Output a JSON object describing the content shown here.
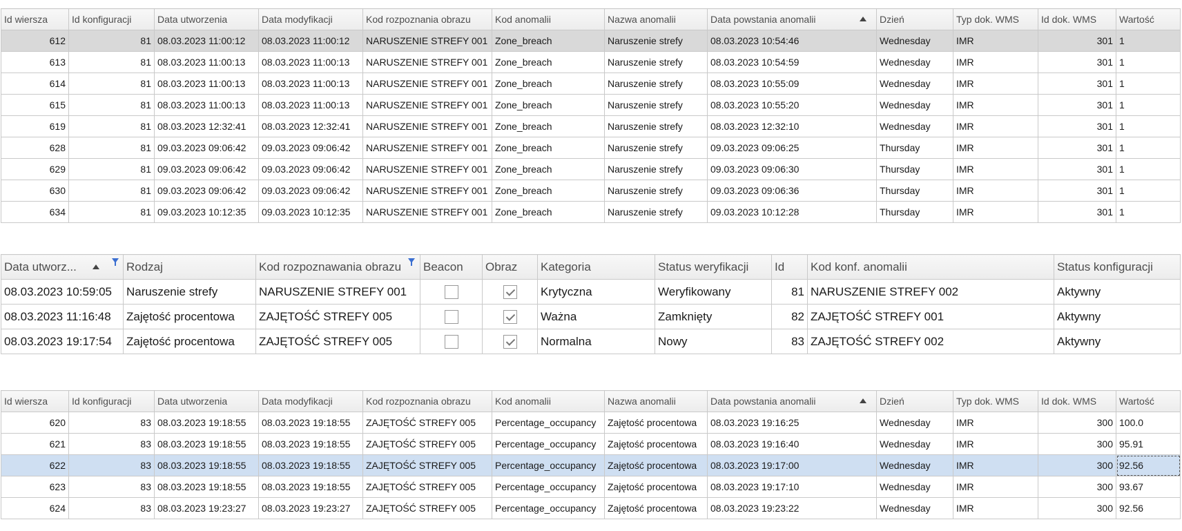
{
  "grid1": {
    "columns": [
      "Id wiersza",
      "Id konfiguracji",
      "Data utworzenia",
      "Data modyfikacji",
      "Kod rozpoznania obrazu",
      "Kod anomalii",
      "Nazwa anomalii",
      "Data powstania anomalii",
      "Dzień",
      "Typ dok. WMS",
      "Id dok. WMS",
      "Wartość"
    ],
    "sorted_column": "Data powstania anomalii",
    "sort_direction": "ascending",
    "rows": [
      [
        "612",
        "81",
        "08.03.2023 11:00:12",
        "08.03.2023 11:00:12",
        "NARUSZENIE STREFY 001",
        "Zone_breach",
        "Naruszenie strefy",
        "08.03.2023 10:54:46",
        "Wednesday",
        "IMR",
        "301",
        "1"
      ],
      [
        "613",
        "81",
        "08.03.2023 11:00:13",
        "08.03.2023 11:00:13",
        "NARUSZENIE STREFY 001",
        "Zone_breach",
        "Naruszenie strefy",
        "08.03.2023 10:54:59",
        "Wednesday",
        "IMR",
        "301",
        "1"
      ],
      [
        "614",
        "81",
        "08.03.2023 11:00:13",
        "08.03.2023 11:00:13",
        "NARUSZENIE STREFY 001",
        "Zone_breach",
        "Naruszenie strefy",
        "08.03.2023 10:55:09",
        "Wednesday",
        "IMR",
        "301",
        "1"
      ],
      [
        "615",
        "81",
        "08.03.2023 11:00:13",
        "08.03.2023 11:00:13",
        "NARUSZENIE STREFY 001",
        "Zone_breach",
        "Naruszenie strefy",
        "08.03.2023 10:55:20",
        "Wednesday",
        "IMR",
        "301",
        "1"
      ],
      [
        "619",
        "81",
        "08.03.2023 12:32:41",
        "08.03.2023 12:32:41",
        "NARUSZENIE STREFY 001",
        "Zone_breach",
        "Naruszenie strefy",
        "08.03.2023 12:32:10",
        "Wednesday",
        "IMR",
        "301",
        "1"
      ],
      [
        "628",
        "81",
        "09.03.2023 09:06:42",
        "09.03.2023 09:06:42",
        "NARUSZENIE STREFY 001",
        "Zone_breach",
        "Naruszenie strefy",
        "09.03.2023 09:06:25",
        "Thursday",
        "IMR",
        "301",
        "1"
      ],
      [
        "629",
        "81",
        "09.03.2023 09:06:42",
        "09.03.2023 09:06:42",
        "NARUSZENIE STREFY 001",
        "Zone_breach",
        "Naruszenie strefy",
        "09.03.2023 09:06:30",
        "Thursday",
        "IMR",
        "301",
        "1"
      ],
      [
        "630",
        "81",
        "09.03.2023 09:06:42",
        "09.03.2023 09:06:42",
        "NARUSZENIE STREFY 001",
        "Zone_breach",
        "Naruszenie strefy",
        "09.03.2023 09:06:36",
        "Thursday",
        "IMR",
        "301",
        "1"
      ],
      [
        "634",
        "81",
        "09.03.2023 10:12:35",
        "09.03.2023 10:12:35",
        "NARUSZENIE STREFY 001",
        "Zone_breach",
        "Naruszenie strefy",
        "09.03.2023 10:12:28",
        "Thursday",
        "IMR",
        "301",
        "1"
      ]
    ]
  },
  "grid2": {
    "columns": [
      "Data utworz...",
      "Rodzaj",
      "Kod rozpoznawania obrazu",
      "Beacon",
      "Obraz",
      "Kategoria",
      "Status weryfikacji",
      "Id",
      "Kod konf. anomalii",
      "Status konfiguracji"
    ],
    "rows": [
      {
        "data": "08.03.2023 10:59:05",
        "rodzaj": "Naruszenie strefy",
        "kod": "NARUSZENIE STREFY 001",
        "beacon": false,
        "obraz": true,
        "kategoria": "Krytyczna",
        "status": "Weryfikowany",
        "id": "81",
        "kod_konf": "NARUSZENIE STREFY 002",
        "status_konf": "Aktywny"
      },
      {
        "data": "08.03.2023 11:16:48",
        "rodzaj": "Zajętość procentowa",
        "kod": "ZAJĘTOŚĆ STREFY 005",
        "beacon": false,
        "obraz": true,
        "kategoria": "Ważna",
        "status": "Zamknięty",
        "id": "82",
        "kod_konf": "ZAJĘTOŚĆ STREFY 001",
        "status_konf": "Aktywny"
      },
      {
        "data": "08.03.2023 19:17:54",
        "rodzaj": "Zajętość procentowa",
        "kod": "ZAJĘTOŚĆ STREFY 005",
        "beacon": false,
        "obraz": true,
        "kategoria": "Normalna",
        "status": "Nowy",
        "id": "83",
        "kod_konf": "ZAJĘTOŚĆ STREFY 002",
        "status_konf": "Aktywny"
      }
    ]
  },
  "grid3": {
    "columns": [
      "Id wiersza",
      "Id konfiguracji",
      "Data utworzenia",
      "Data modyfikacji",
      "Kod rozpoznania obrazu",
      "Kod anomalii",
      "Nazwa anomalii",
      "Data powstania anomalii",
      "Dzień",
      "Typ dok. WMS",
      "Id dok. WMS",
      "Wartość"
    ],
    "rows": [
      [
        "620",
        "83",
        "08.03.2023 19:18:55",
        "08.03.2023 19:18:55",
        "ZAJĘTOŚĆ STREFY 005",
        "Percentage_occupancy",
        "Zajętość procentowa",
        "08.03.2023 19:16:25",
        "Wednesday",
        "IMR",
        "300",
        "100.0"
      ],
      [
        "621",
        "83",
        "08.03.2023 19:18:55",
        "08.03.2023 19:18:55",
        "ZAJĘTOŚĆ STREFY 005",
        "Percentage_occupancy",
        "Zajętość procentowa",
        "08.03.2023 19:16:40",
        "Wednesday",
        "IMR",
        "300",
        "95.91"
      ],
      [
        "622",
        "83",
        "08.03.2023 19:18:55",
        "08.03.2023 19:18:55",
        "ZAJĘTOŚĆ STREFY 005",
        "Percentage_occupancy",
        "Zajętość procentowa",
        "08.03.2023 19:17:00",
        "Wednesday",
        "IMR",
        "300",
        "92.56"
      ],
      [
        "623",
        "83",
        "08.03.2023 19:18:55",
        "08.03.2023 19:18:55",
        "ZAJĘTOŚĆ STREFY 005",
        "Percentage_occupancy",
        "Zajętość procentowa",
        "08.03.2023 19:17:10",
        "Wednesday",
        "IMR",
        "300",
        "93.67"
      ],
      [
        "624",
        "83",
        "08.03.2023 19:23:27",
        "08.03.2023 19:23:27",
        "ZAJĘTOŚĆ STREFY 005",
        "Percentage_occupancy",
        "Zajętość procentowa",
        "08.03.2023 19:23:22",
        "Wednesday",
        "IMR",
        "300",
        "92.56"
      ]
    ]
  },
  "colors": {
    "selected_row_grey": "#d9d9d9",
    "selected_row_blue": "#cfdff2",
    "header_bg": "#ececec",
    "grid_line": "#c9c9c9",
    "filter_icon": "#3b6fd1"
  }
}
